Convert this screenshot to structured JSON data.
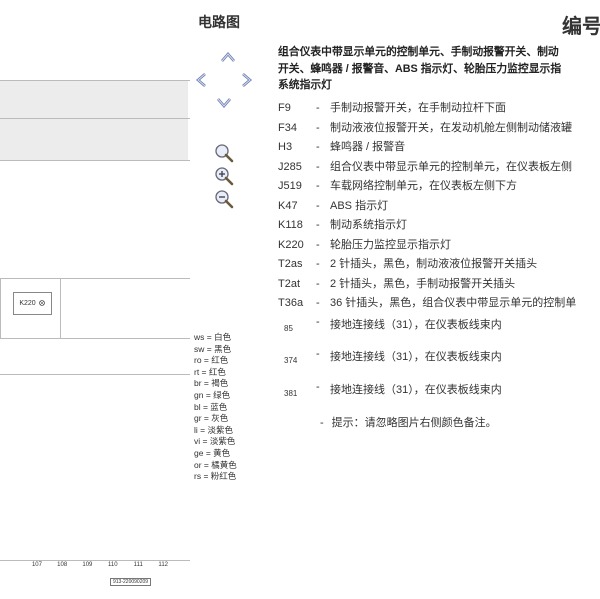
{
  "diagram": {
    "component_label": "K220",
    "column_numbers": [
      "107",
      "108",
      "109",
      "110",
      "111",
      "112"
    ],
    "document_number": "913-220090209"
  },
  "sidebar": {
    "title": "电路图",
    "legend": [
      "ws = 白色",
      "sw = 黑色",
      "ro = 红色",
      "rt = 红色",
      "br = 褐色",
      "gn = 绿色",
      "bl = 蓝色",
      "gr = 灰色",
      "li = 淡紫色",
      "vi = 淡紫色",
      "ge = 黄色",
      "or = 橘黄色",
      "rs = 粉红色"
    ]
  },
  "page": {
    "title": "编号",
    "heading_lines": [
      "组合仪表中带显示单元的控制单元、手制动报警开关、制动",
      "开关、蜂鸣器 / 报警音、ABS 指示灯、轮胎压力监控显示指",
      "系统指示灯"
    ],
    "items": [
      {
        "code": "F9",
        "desc": "手制动报警开关，在手制动拉杆下面"
      },
      {
        "code": "F34",
        "desc": "制动液液位报警开关，在发动机舱左侧制动储液罐"
      },
      {
        "code": "H3",
        "desc": "蜂鸣器 / 报警音"
      },
      {
        "code": "J285",
        "desc": "组合仪表中带显示单元的控制单元，在仪表板左侧"
      },
      {
        "code": "J519",
        "desc": "车载网络控制单元，在仪表板左侧下方"
      },
      {
        "code": "K47",
        "desc": "ABS 指示灯"
      },
      {
        "code": "K118",
        "desc": "制动系统指示灯"
      },
      {
        "code": "K220",
        "desc": "轮胎压力监控显示指示灯"
      },
      {
        "code": "T2as",
        "desc": "2 针插头，黑色，制动液液位报警开关插头"
      },
      {
        "code": "T2at",
        "desc": "2 针插头，黑色，手制动报警开关插头"
      },
      {
        "code": "T36a",
        "desc": "36 针插头，黑色，组合仪表中带显示单元的控制单"
      }
    ],
    "grounds": [
      {
        "code": "85",
        "desc": "接地连接线（31），在仪表板线束内"
      },
      {
        "code": "374",
        "desc": "接地连接线（31），在仪表板线束内"
      },
      {
        "code": "381",
        "desc": "接地连接线（31），在仪表板线束内"
      }
    ],
    "dash": "-",
    "note": "提示：请忽略图片右侧颜色备注。"
  }
}
